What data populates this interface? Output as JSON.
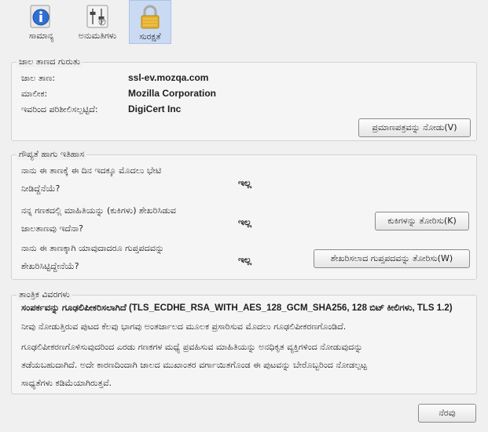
{
  "tabs": [
    {
      "label": "ಸಾಮಾನ್ಯ",
      "icon": "info-icon"
    },
    {
      "label": "ಅನುಮತಿಗಳು",
      "icon": "permissions-icon"
    },
    {
      "label": "ಸುರಕ್ಷತೆ",
      "icon": "lock-icon"
    }
  ],
  "identity": {
    "legend": "ಜಾಲ ತಾಣದ ಗುರುತು",
    "site_label": "ಜಾಲ ತಾಣ:",
    "site_value": "ssl-ev.mozqa.com",
    "owner_label": "ಮಾಲೀಕ:",
    "owner_value": "Mozilla Corporation",
    "verifier_label": "ಇವರಿಂದ ಪರಿಶೀಲಿಸಲ್ಪಟ್ಟಿದೆ:",
    "verifier_value": "DigiCert Inc",
    "view_cert_button": "ಪ್ರಮಾಣಪತ್ರವನ್ನು ನೋಡು(V)"
  },
  "privacy": {
    "legend": "ಗೌಪ್ಯತೆ ಹಾಗು ಇತಿಹಾಸ",
    "q1_line1": "ನಾನು ಈ ತಾಣಕ್ಕೆ ಈ ದಿನ ಇದಕ್ಕೂ ಮೊದಲು ಭೇಟಿ",
    "q1_line2": "ನೀಡಿದ್ದೆನೆಯೆ?",
    "q1_answer": "ಇಲ್ಲ",
    "q2_line1": "ನನ್ನ ಗಣಕದಲ್ಲಿ ಮಾಹಿತಿಯನ್ನು (ಕುಕಿಗಳು) ಶೇಖರಿಸಿಡುವ",
    "q2_line2": "ಜಾಲತಾಣವು ಇದೆನಾ?",
    "q2_answer": "ಇಲ್ಲ",
    "cookies_button": "ಕುಕಿಗಳನ್ನು ತೋರಿಸು(K)",
    "q3_line1": "ನಾನು ಈ ತಾಣಕ್ಕಾಗಿ ಯಾವುದಾದರೂ ಗುಪ್ತಪದವನ್ನು",
    "q3_line2": "ಶೇಖರಿಸಿಟ್ಟಿದ್ದೇನೆಯೆ?",
    "q3_answer": "ಇಲ್ಲ",
    "passwords_button": "ಶೇಖರಿಸಲಾದ ಗುಪ್ತಪದವನ್ನು ತೋರಿಸು(W)"
  },
  "technical": {
    "legend": "ತಾಂತ್ರಿಕ ವಿವರಗಳು",
    "line1": "ಸಂಪರ್ಕವನ್ನು ಗೂಢಲಿಪೀಕರಿಸಲಾಗಿದೆ (TLS_ECDHE_RSA_WITH_AES_128_GCM_SHA256, 128 ಬಿಟ್ ಕೀಲಿಗಳು, TLS 1.2)",
    "line2": "ನೀವು ನೋಡುತ್ತಿರುವ ಪುಟದ ಕೆಲವು ಭಾಗವು ಅಂತರ್ಜಾಲದ ಮೂಲಕ ಪ್ರಸಾರಿಸುವ ಮೊದಲು ಗೂಢಲಿಪೀಕರಣಗೊಂಡಿದೆ.",
    "para_line1": "ಗೂಢಲಿಪೀಕರಣಗೊಳಿಸುವುದರಿಂದ ಎರಡು ಗಣಕಗಳ ಮಧ್ಯೆ ಪ್ರವಹಿಸುವ ಮಾಹಿತಿಯನ್ನು ಅನಧಿಕೃತ ವ್ಯಕ್ತಿಗಳಿಂದ ನೋಡುವುದನ್ನು",
    "para_line2": "ತಡೆಯಬಹುದಾಗಿದೆ. ಅದೇ ಕಾರಣದಿಂದಾಗಿ ಜಾಲದ ಮುಖಾಂತರ ವರ್ಗಾಯಿತಗೊಂಡ ಈ ಪುಟವನ್ನು ಬೇರೊಬ್ಬರಿಂದ ನೋಡಲ್ಪಟ್ಟ",
    "para_line3": "ಸಾಧ್ಯತೆಗಳು ಕಡಿಮೆಯಾಗಿರುತ್ತವೆ."
  },
  "help_button": "ನೆರವು"
}
